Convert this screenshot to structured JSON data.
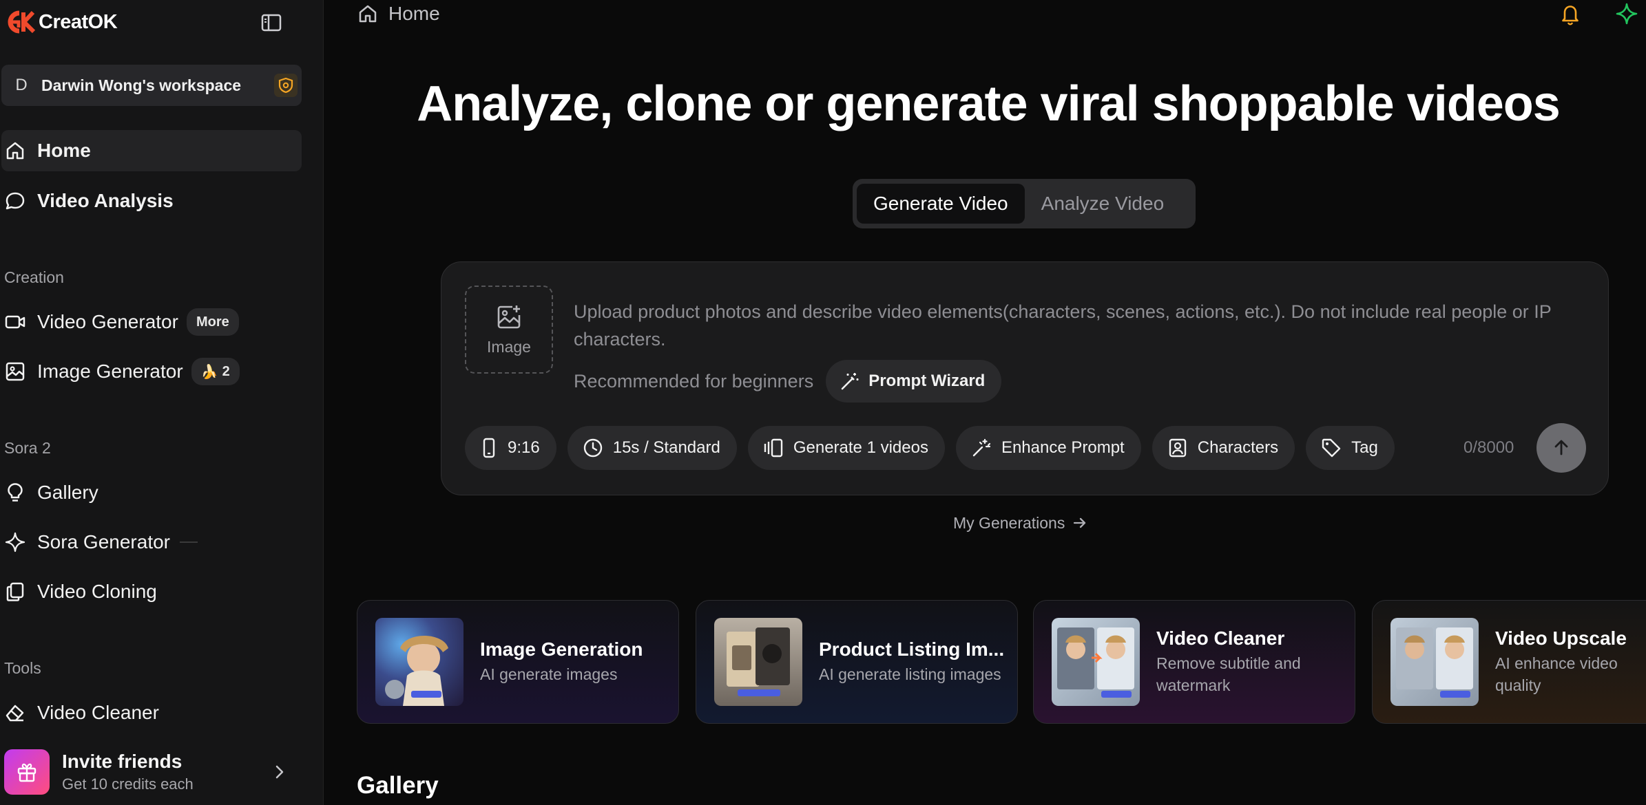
{
  "app": {
    "name": "CreatOK"
  },
  "workspace": {
    "initial": "D",
    "name": "Darwin Wong's workspace"
  },
  "sidebar": {
    "main": [
      {
        "label": "Home",
        "icon": "home-icon",
        "active": true
      },
      {
        "label": "Video Analysis",
        "icon": "chat-bubble-icon"
      }
    ],
    "sections": [
      {
        "title": "Creation",
        "items": [
          {
            "label": "Video Generator",
            "icon": "video-camera-icon",
            "badge": "More"
          },
          {
            "label": "Image Generator",
            "icon": "image-icon",
            "badge_emoji": "🍌",
            "badge": "2"
          }
        ]
      },
      {
        "title": "Sora 2",
        "items": [
          {
            "label": "Gallery",
            "icon": "lightbulb-icon"
          },
          {
            "label": "Sora Generator",
            "icon": "sparkle-icon"
          },
          {
            "label": "Video Cloning",
            "icon": "copy-icon"
          }
        ]
      },
      {
        "title": "Tools",
        "items": [
          {
            "label": "Video Cleaner",
            "icon": "eraser-icon"
          }
        ]
      }
    ],
    "invite": {
      "title": "Invite friends",
      "subtitle": "Get 10 credits each"
    }
  },
  "topbar": {
    "breadcrumb": "Home"
  },
  "hero": {
    "title": "Analyze, clone or generate viral shoppable videos"
  },
  "mode_tabs": [
    {
      "label": "Generate Video",
      "active": true
    },
    {
      "label": "Analyze Video",
      "active": false
    }
  ],
  "prompt": {
    "upload_label": "Image",
    "placeholder": "Upload product photos and describe video elements(characters, scenes, actions, etc.). Do not include real people or IP characters.",
    "recommend_label": "Recommended for beginners",
    "wizard_label": "Prompt Wizard",
    "options": {
      "aspect": "9:16",
      "duration": "15s / Standard",
      "count": "Generate 1 videos",
      "enhance": "Enhance Prompt",
      "characters": "Characters",
      "tag": "Tag"
    },
    "char_count": "0/8000"
  },
  "my_generations": "My Generations",
  "cards": [
    {
      "title": "Image Generation",
      "subtitle": "AI generate images"
    },
    {
      "title": "Product Listing Im...",
      "subtitle": "AI generate listing images"
    },
    {
      "title": "Video Cleaner",
      "subtitle": "Remove subtitle and watermark"
    },
    {
      "title": "Video Upscale",
      "subtitle": "AI enhance video quality"
    }
  ],
  "gallery_title": "Gallery",
  "colors": {
    "background": "#0a0a0a",
    "sidebar": "#151516",
    "accent_orange": "#f5a524",
    "accent_green": "#22c55e",
    "logo_red": "#f04a2c"
  }
}
